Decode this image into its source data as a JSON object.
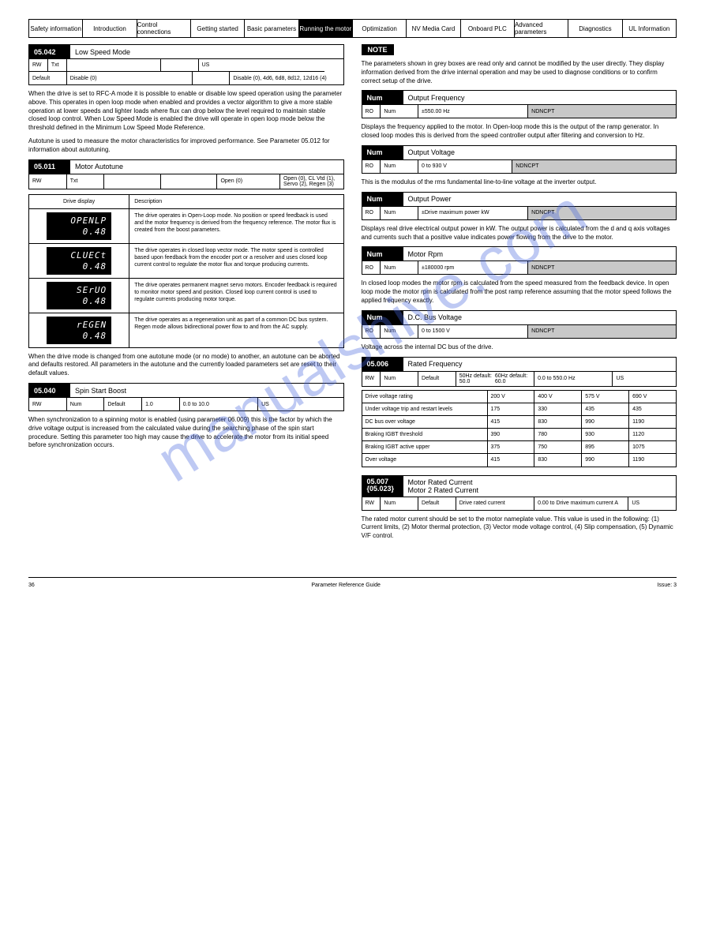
{
  "menu": [
    "Safety information",
    "Introduction",
    "Control connections",
    "Getting started",
    "Basic parameters",
    "Running the motor",
    "Optimization",
    "NV Media Card",
    "Onboard PLC",
    "Advanced parameters",
    "Diagnostics",
    "UL Information"
  ],
  "menu_active_index": 5,
  "left": {
    "p05_042": {
      "num": "05.042",
      "title": "Low Speed Mode",
      "rw": "RW",
      "txt": "Txt",
      "us": "US",
      "default": "Disable (0)",
      "drng": "Disable (0), 4d6, 6d8, 8d12, 12d16 (4)",
      "defcol": "Default"
    },
    "p05_042_text": "When the drive is set to RFC-A mode it is possible to enable or disable low speed operation using the parameter above. This operates in open loop mode when enabled and provides a vector algorithm to give a more stable operation at lower speeds and lighter loads where flux can drop below the level required to maintain stable closed loop control. When Low Speed Mode is enabled the drive will operate in open loop mode below the threshold defined in the Minimum Low Speed Mode Reference.",
    "p05_011_text": "Autotune is used to measure the motor characteristics for improved performance. See Parameter 05.012 for information about autotuning.",
    "p05_011": {
      "num": "05.011",
      "title": "Motor Autotune",
      "rw": "RW",
      "txt": "Txt",
      "us": "",
      "default": "Open (0)",
      "defcol": "Default",
      "opts": "Open (0), CL Vtd (1), Servo (2), Regen (3)"
    },
    "display_table": [
      {
        "d1": "OPENLP",
        "d2": "0.48",
        "desc": "The drive operates in Open-Loop mode. No position or speed feedback is used and the motor frequency is derived from the frequency reference. The motor flux is created from the boost parameters."
      },
      {
        "d1": "CLUECt",
        "d2": "0.48",
        "desc": "The drive operates in closed loop vector mode. The motor speed is controlled based upon feedback from the encoder port or a resolver and uses closed loop current control to regulate the motor flux and torque producing currents."
      },
      {
        "d1": "SErUO",
        "d2": "0.48",
        "desc": "The drive operates permanent magnet servo motors. Encoder feedback is required to monitor motor speed and position. Closed loop current control is used to regulate currents producing motor torque."
      },
      {
        "d1": "rEGEN",
        "d2": "0.48",
        "desc": "The drive operates as a regeneration unit as part of a common DC bus system. Regen mode allows bidirectional power flow to and from the AC supply."
      }
    ],
    "p05_011_footer": "When the drive mode is changed from one autotune mode (or no mode) to another, an autotune can be aborted and defaults restored. All parameters in the autotune and the currently loaded parameters set are reset to their default values.",
    "p05_040": {
      "num": "05.040",
      "title": "Spin Start Boost",
      "rw": "RW",
      "num2": "Num",
      "us": "US",
      "def_label": "Default",
      "def_val": "1.0",
      "range": "0.0 to 10.0"
    },
    "p05_040_text": "When synchronization to a spinning motor is enabled (using parameter 06.009) this is the factor by which the drive voltage output is increased from the calculated value during the searching phase of the spin start procedure. Setting this parameter too high may cause the drive to accelerate the motor from its initial speed before synchronization occurs."
  },
  "right": {
    "note": "NOTE",
    "note_text": "The parameters shown in grey boxes are read only and cannot be modified by the user directly. They display information derived from the drive internal operation and may be used to diagnose conditions or to confirm correct setup of the drive.",
    "p05_001": {
      "num": "Num",
      "title": "Output Frequency",
      "ro": "RO",
      "nd": "ND",
      "nc": "NC",
      "pt": "PT",
      "range": "±550.00 Hz"
    },
    "p05_001_text": "Displays the frequency applied to the motor. In Open-loop mode this is the output of the ramp generator. In closed loop modes this is derived from the speed controller output after filtering and conversion to Hz.",
    "p05_002": {
      "num": "Num",
      "title": "Output Voltage",
      "ro": "RO",
      "nd": "ND",
      "nc": "NC",
      "pt": "PT",
      "range": "0 to 930 V"
    },
    "p05_002_text": "This is the modulus of the rms fundamental line-to-line voltage at the inverter output.",
    "p05_003": {
      "num": "Num",
      "title": "Output Power",
      "ro": "RO",
      "nd": "ND",
      "nc": "NC",
      "pt": "PT",
      "range": "±Drive maximum power kW"
    },
    "p05_003_text": "Displays real drive electrical output power in kW. The output power is calculated from the d and q axis voltages and currents such that a positive value indicates power flowing from the drive to the motor.",
    "p05_004": {
      "num": "Num",
      "title": "Motor Rpm",
      "ro": "RO",
      "nd": "ND",
      "nc": "NC",
      "pt": "PT",
      "range": "±180000 rpm"
    },
    "p05_004_text": "In closed loop modes the motor rpm is calculated from the speed measured from the feedback device. In open loop mode the motor rpm is calculated from the post ramp reference assuming that the motor speed follows the applied frequency exactly.",
    "p05_005": {
      "num": "Num",
      "title": "D.C. Bus Voltage",
      "ro": "RO",
      "nd": "ND",
      "nc": "NC",
      "pt": "PT",
      "range": "0 to 1500 V"
    },
    "p05_005_text": "Voltage across the internal DC bus of the drive.",
    "p05_006": {
      "num": "05.006",
      "title": "Rated Frequency",
      "rw": "RW",
      "num2": "Num",
      "us": "US",
      "def_label": "Default",
      "def_val_a": "50Hz default: 50.0",
      "def_val_b": "60Hz default: 60.0",
      "range": "0.0 to 550.0 Hz"
    },
    "volt_table": {
      "head": [
        "Drive voltage rating",
        "200 V",
        "400 V",
        "575 V",
        "690 V"
      ],
      "rows": [
        [
          "Under voltage trip and restart levels",
          "175",
          "330",
          "435",
          "435"
        ],
        [
          "DC bus over voltage",
          "415",
          "830",
          "990",
          "1190"
        ],
        [
          "Braking IGBT threshold",
          "390",
          "780",
          "930",
          "1120"
        ],
        [
          "Braking IGBT active upper",
          "375",
          "750",
          "895",
          "1075"
        ],
        [
          "Over voltage",
          "415",
          "830",
          "990",
          "1190"
        ]
      ]
    },
    "p05_007": {
      "num": "05.007",
      "num2": "{05.023}",
      "title": "Motor Rated Current",
      "title2": "Motor 2 Rated Current",
      "rw": "RW",
      "num3": "Num",
      "us": "US",
      "def_label": "Default",
      "def_val": "Drive rated current",
      "range": "0.00 to Drive maximum current A"
    },
    "p05_007_text": "The rated motor current should be set to the motor nameplate value. This value is used in the following: (1) Current limits, (2) Motor thermal protection, (3) Vector mode voltage control, (4) Slip compensation, (5) Dynamic V/F control."
  },
  "footer": {
    "left": "36",
    "mid": "Parameter Reference Guide",
    "right": "Issue: 3"
  }
}
